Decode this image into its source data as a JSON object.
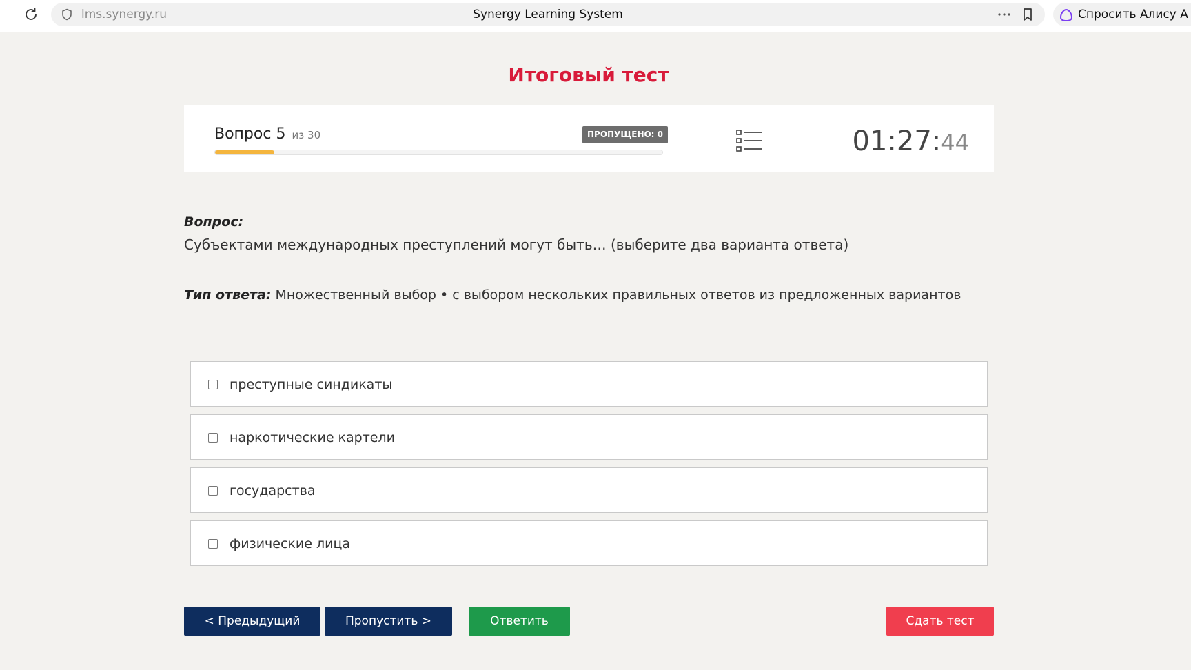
{
  "browser": {
    "url": "lms.synergy.ru",
    "title": "Synergy Learning System",
    "alice_label": "Спросить Алису А"
  },
  "page": {
    "title": "Итоговый тест"
  },
  "progress": {
    "question_label": "Вопрос 5",
    "question_of": "из 30",
    "current": 5,
    "total": 30,
    "skipped_label": "ПРОПУЩЕНО: 0",
    "progress_fraction": 0.133,
    "timer_main": "01:27:",
    "timer_seconds": "44"
  },
  "question": {
    "label": "Вопрос:",
    "text": "Субъектами международных преступлений могут быть… (выберите два варианта ответа)",
    "answer_type_label": "Тип ответа:",
    "answer_type_value": "Множественный выбор • с выбором нескольких правильных ответов из предложенных вариантов"
  },
  "options": [
    {
      "label": "преступные синдикаты",
      "checked": false
    },
    {
      "label": "наркотические картели",
      "checked": false
    },
    {
      "label": "государства",
      "checked": false
    },
    {
      "label": "физические лица",
      "checked": false
    }
  ],
  "buttons": {
    "prev": "< Предыдущий",
    "skip": "Пропустить >",
    "answer": "Ответить",
    "finish": "Сдать тест"
  },
  "colors": {
    "title_red": "#d81b3a",
    "navy": "#0e2d5e",
    "green": "#1e9a4b",
    "finish_red": "#f03e4e",
    "progress_orange": "#f4b53e"
  }
}
